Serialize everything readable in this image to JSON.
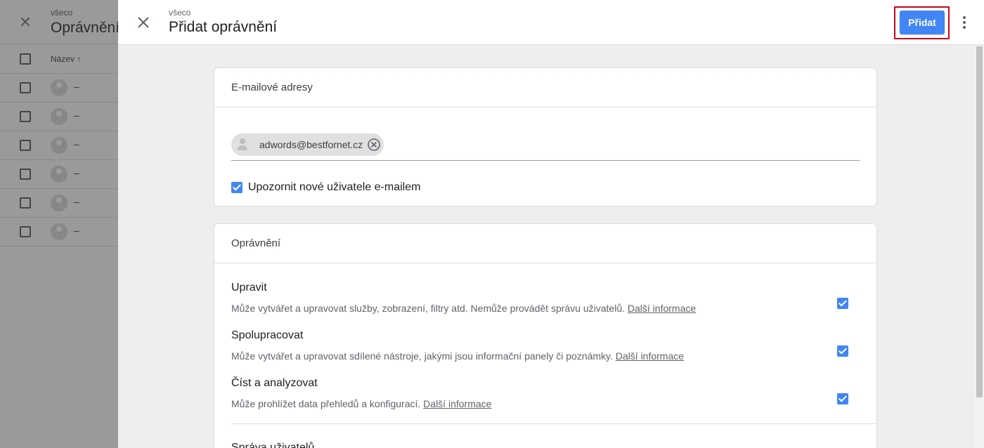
{
  "background": {
    "breadcrumb": "všeco",
    "title": "Oprávnění",
    "column_header": "Název ↑",
    "rows": [
      "–",
      "–",
      "–",
      "–",
      "–",
      "–"
    ]
  },
  "header": {
    "breadcrumb": "všeco",
    "title": "Přidat oprávnění",
    "add_button": "Přidat"
  },
  "email_card": {
    "title": "E-mailové adresy",
    "chip_email": "adwords@bestfornet.cz",
    "notify_label": "Upozornit nové uživatele e-mailem",
    "notify_checked": true
  },
  "permissions_card": {
    "title": "Oprávnění",
    "items": [
      {
        "name": "Upravit",
        "desc": "Může vytvářet a upravovat služby, zobrazení, filtry atd. Nemůže provádět správu uživatelů.",
        "link": "Další informace",
        "checked": true
      },
      {
        "name": "Spolupracovat",
        "desc": "Může vytvářet a upravovat sdílené nástroje, jakými jsou informační panely či poznámky.",
        "link": "Další informace",
        "checked": true
      },
      {
        "name": "Číst a analyzovat",
        "desc": "Může prohlížet data přehledů a konfigurací.",
        "link": "Další informace",
        "checked": true
      }
    ],
    "next_item": "Správa uživatelů"
  },
  "colors": {
    "accent": "#4285f4",
    "highlight": "#d0021b"
  }
}
